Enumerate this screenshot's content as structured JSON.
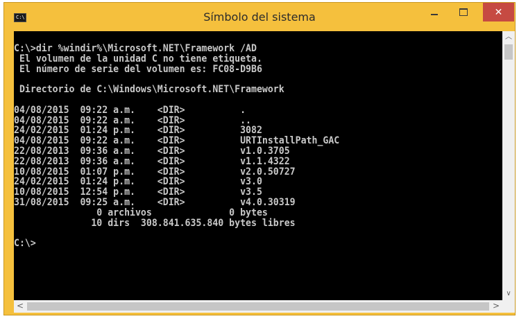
{
  "window": {
    "title": "Símbolo del sistema",
    "icon_label": "C:\\",
    "controls": {
      "minimize": "minimize-icon",
      "maximize": "maximize-icon",
      "close": "✕"
    }
  },
  "console": {
    "lines": [
      "C:\\>dir %windir%\\Microsoft.NET\\Framework /AD",
      " El volumen de la unidad C no tiene etiqueta.",
      " El número de serie del volumen es: FC08-D9B6",
      "",
      " Directorio de C:\\Windows\\Microsoft.NET\\Framework",
      "",
      "04/08/2015  09:22 a.m.    <DIR>          .",
      "04/08/2015  09:22 a.m.    <DIR>          ..",
      "24/02/2015  01:24 p.m.    <DIR>          3082",
      "04/08/2015  09:22 a.m.    <DIR>          URTInstallPath_GAC",
      "22/08/2013  09:36 a.m.    <DIR>          v1.0.3705",
      "22/08/2013  09:36 a.m.    <DIR>          v1.1.4322",
      "10/08/2015  01:07 p.m.    <DIR>          v2.0.50727",
      "24/02/2015  01:24 p.m.    <DIR>          v3.0",
      "10/08/2015  12:54 p.m.    <DIR>          v3.5",
      "31/08/2015  09:25 a.m.    <DIR>          v4.0.30319",
      "               0 archivos              0 bytes",
      "              10 dirs  308.841.635.840 bytes libres",
      "",
      "C:\\>"
    ]
  },
  "scrollbars": {
    "vertical": {
      "up": "▲",
      "down": "∨"
    },
    "horizontal": {
      "left": "<",
      "right": ">"
    }
  }
}
